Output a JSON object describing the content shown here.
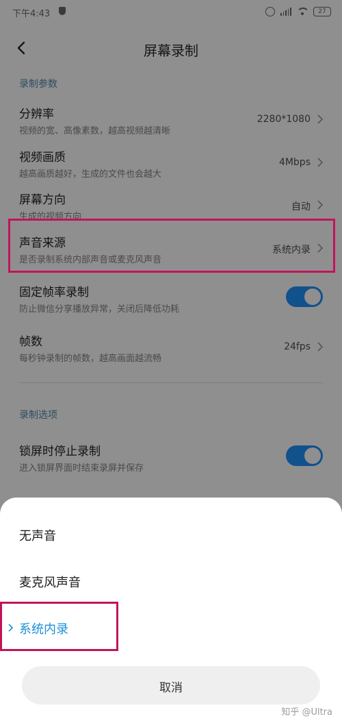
{
  "status_bar": {
    "time": "下午4:43",
    "battery": "27"
  },
  "header": {
    "title": "屏幕录制"
  },
  "sections": {
    "record_params_label": "录制参数",
    "record_options_label": "录制选项"
  },
  "settings": {
    "resolution": {
      "title": "分辨率",
      "subtitle": "视频的宽、高像素数，越高视频越清晰",
      "value": "2280*1080"
    },
    "quality": {
      "title": "视频画质",
      "subtitle": "越高画质越好，生成的文件也会越大",
      "value": "4Mbps"
    },
    "orientation": {
      "title": "屏幕方向",
      "subtitle": "生成的视频方向",
      "value": "自动"
    },
    "audio_source": {
      "title": "声音来源",
      "subtitle": "是否录制系统内部声音或麦克风声音",
      "value": "系统内录"
    },
    "fixed_framerate": {
      "title": "固定帧率录制",
      "subtitle": "防止微信分享播放异常，关闭后降低功耗",
      "enabled": true
    },
    "framerate": {
      "title": "帧数",
      "subtitle": "每秒钟录制的帧数，越高画面越流畅",
      "value": "24fps"
    },
    "stop_on_lock": {
      "title": "锁屏时停止录制",
      "subtitle": "进入锁屏界面时结束录屏并保存",
      "enabled": true
    }
  },
  "sheet": {
    "options": [
      {
        "label": "无声音",
        "selected": false
      },
      {
        "label": "麦克风声音",
        "selected": false
      },
      {
        "label": "系统内录",
        "selected": true
      }
    ],
    "cancel_label": "取消"
  },
  "watermark": "知乎 @Ultra",
  "colors": {
    "accent": "#1a8fd8",
    "toggle_on": "#11518c",
    "highlight": "#c2145a",
    "dim_background": "#8f8f8f"
  }
}
